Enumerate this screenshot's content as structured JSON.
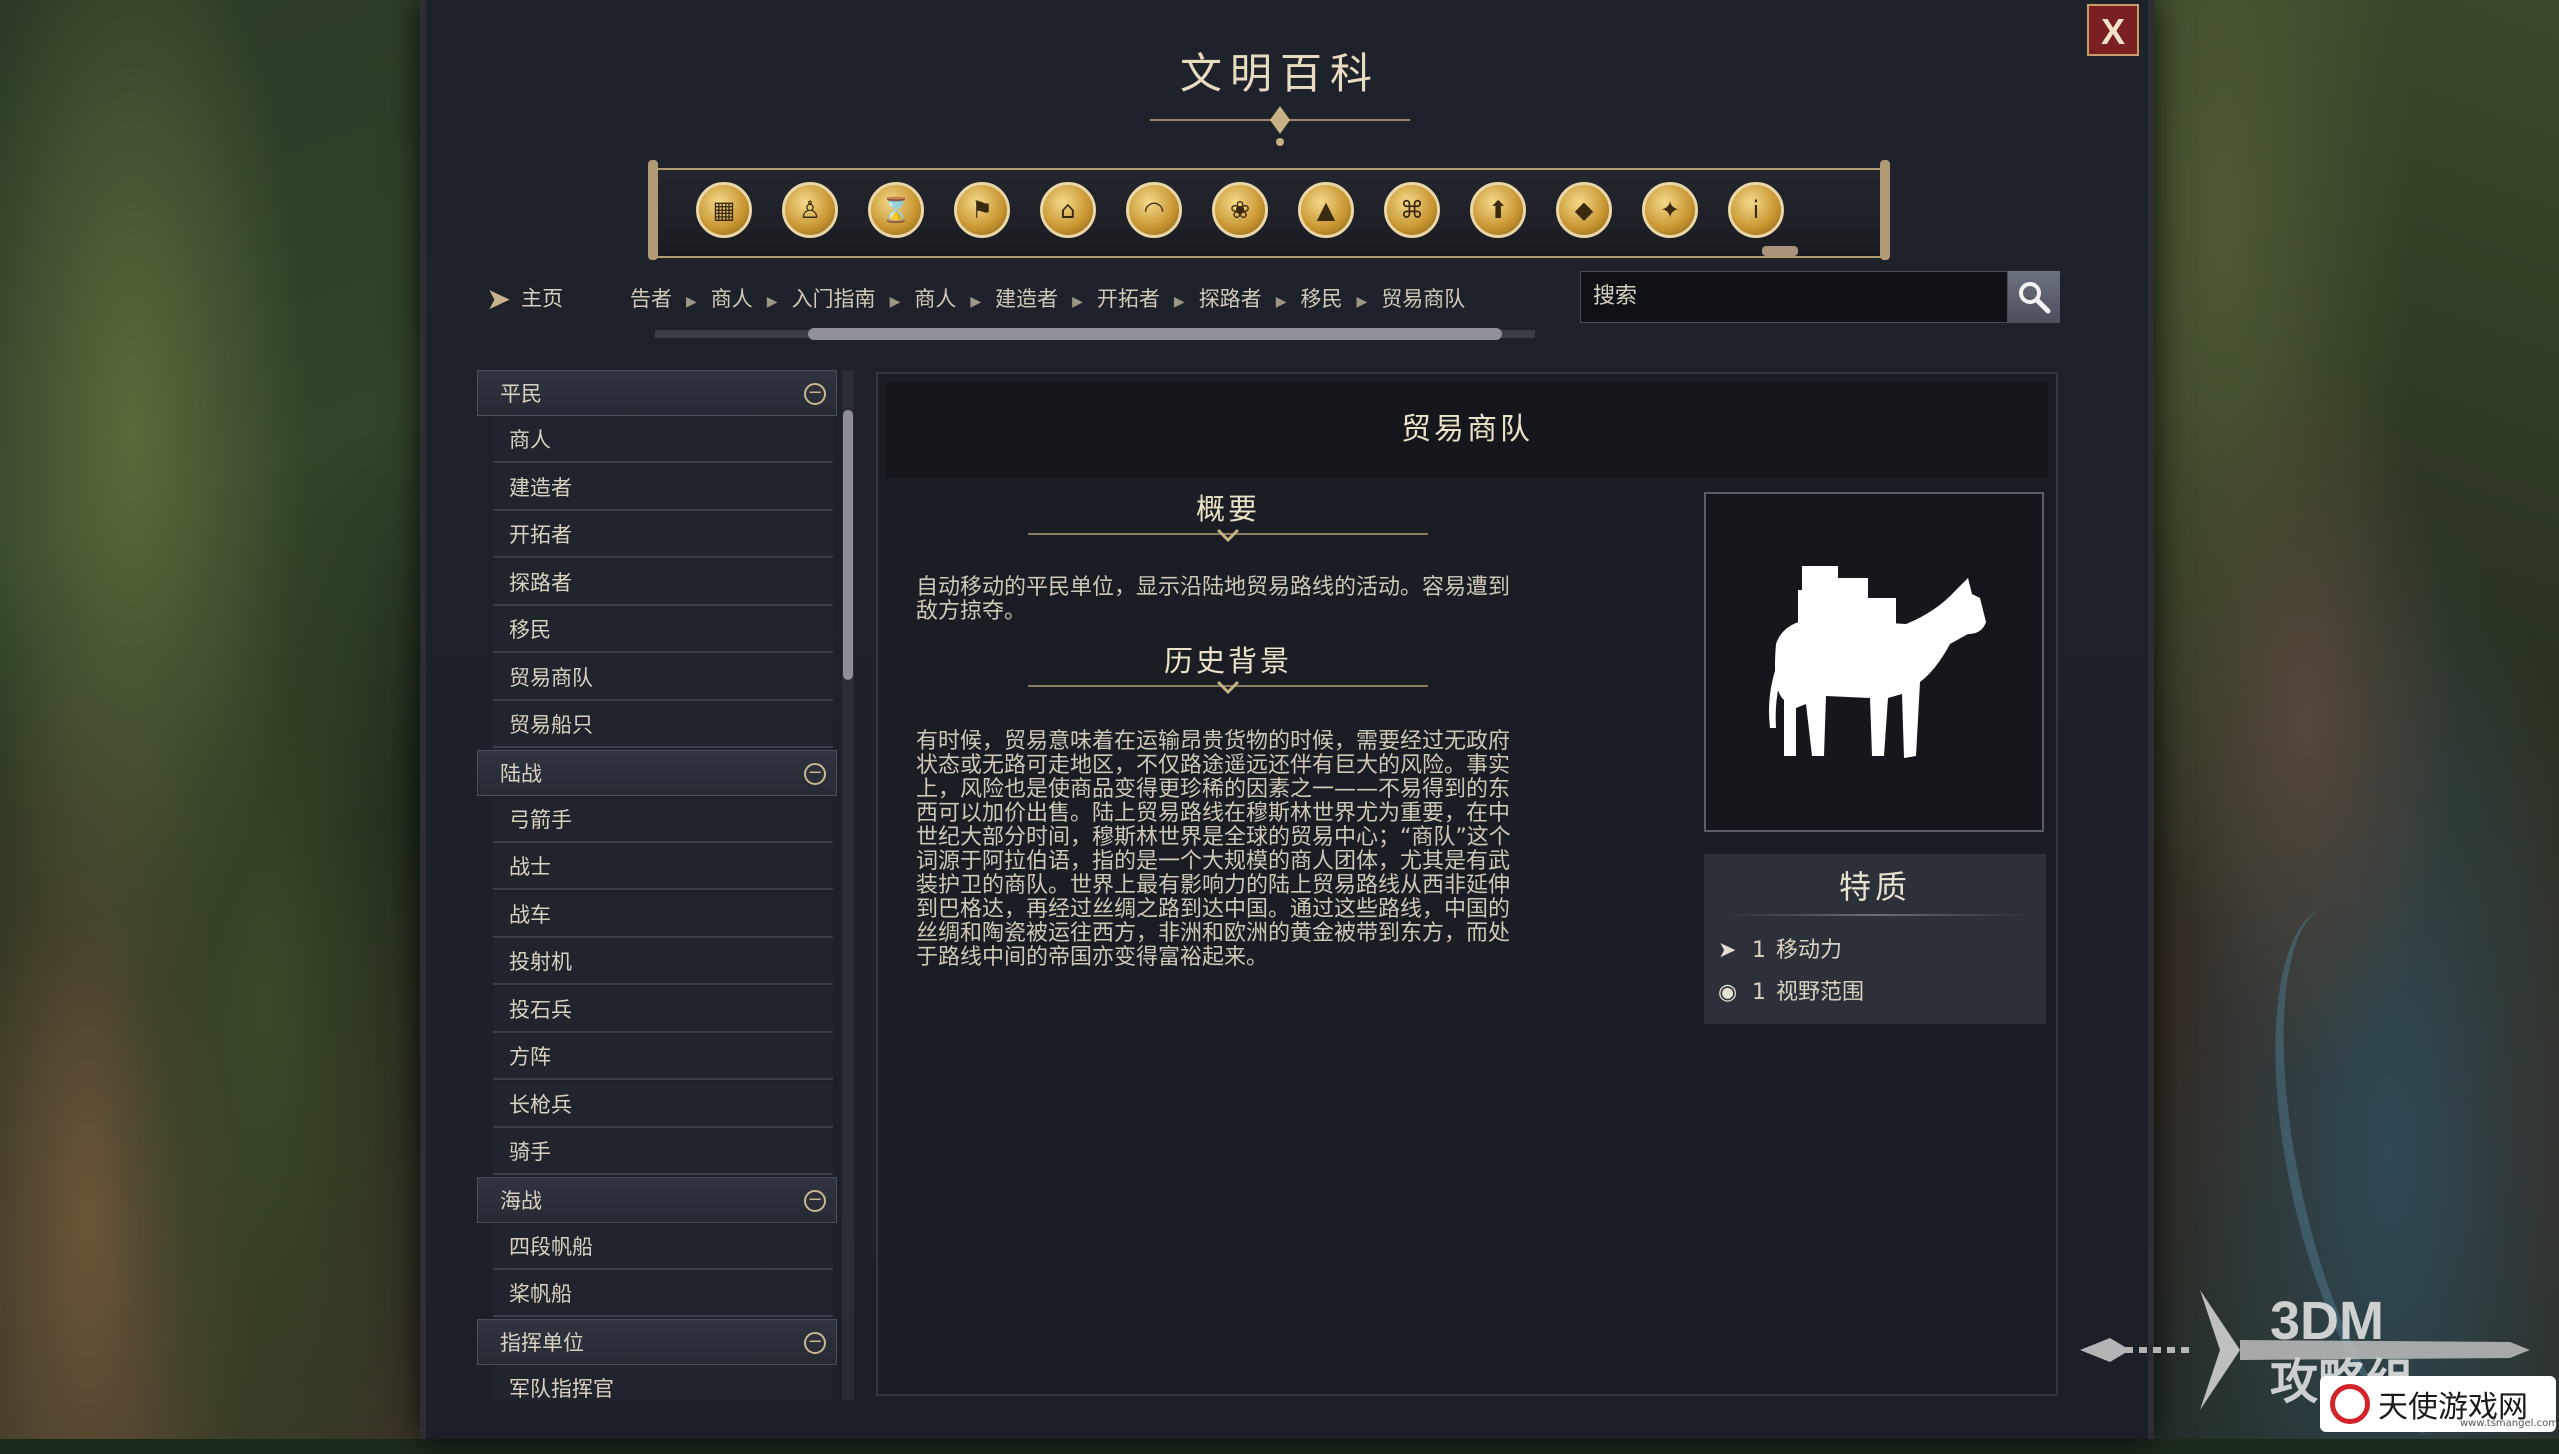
{
  "window": {
    "title": "文明百科",
    "close_label": "X"
  },
  "category_icons": [
    {
      "name": "units-icon",
      "glyph": "▦"
    },
    {
      "name": "resources-icon",
      "glyph": "♙"
    },
    {
      "name": "ages-icon",
      "glyph": "⌛"
    },
    {
      "name": "civilizations-icon",
      "glyph": "⚑"
    },
    {
      "name": "buildings-icon",
      "glyph": "⌂"
    },
    {
      "name": "tiles-icon",
      "glyph": "◠"
    },
    {
      "name": "traditions-icon",
      "glyph": "❀"
    },
    {
      "name": "wonders-icon",
      "glyph": "▲"
    },
    {
      "name": "districts-icon",
      "glyph": "⌘"
    },
    {
      "name": "improvements-icon",
      "glyph": "⬆"
    },
    {
      "name": "technology-icon",
      "glyph": "◆"
    },
    {
      "name": "diplomacy-icon",
      "glyph": "✦"
    },
    {
      "name": "info-icon",
      "glyph": "i"
    }
  ],
  "nav": {
    "home_label": "主页",
    "breadcrumbs": [
      "告者",
      "商人",
      "入门指南",
      "商人",
      "建造者",
      "开拓者",
      "探路者",
      "移民",
      "贸易商队"
    ],
    "search_placeholder": "搜索"
  },
  "sidebar": {
    "groups": [
      {
        "label": "平民",
        "items": [
          "商人",
          "建造者",
          "开拓者",
          "探路者",
          "移民",
          "贸易商队",
          "贸易船只"
        ]
      },
      {
        "label": "陆战",
        "items": [
          "弓箭手",
          "战士",
          "战车",
          "投射机",
          "投石兵",
          "方阵",
          "长枪兵",
          "骑手"
        ]
      },
      {
        "label": "海战",
        "items": [
          "四段帆船",
          "桨帆船"
        ]
      },
      {
        "label": "指挥单位",
        "items": [
          "军队指挥官"
        ]
      }
    ]
  },
  "article": {
    "title": "贸易商队",
    "overview_heading": "概要",
    "overview_text": "自动移动的平民单位，显示沿陆地贸易路线的活动。容易遭到敌方掠夺。",
    "history_heading": "历史背景",
    "history_text": "有时候，贸易意味着在运输昂贵货物的时候，需要经过无政府状态或无路可走地区，不仅路途遥远还伴有巨大的风险。事实上，风险也是使商品变得更珍稀的因素之一——不易得到的东西可以加价出售。陆上贸易路线在穆斯林世界尤为重要，在中世纪大部分时间，穆斯林世界是全球的贸易中心；“商队”这个词源于阿拉伯语，指的是一个大规模的商人团体，尤其是有武装护卫的商队。世界上最有影响力的陆上贸易路线从西非延伸到巴格达，再经过丝绸之路到达中国。通过这些路线，中国的丝绸和陶瓷被运往西方，非洲和欧洲的黄金被带到东方，而处于路线中间的帝国亦变得富裕起来。",
    "traits_heading": "特质",
    "traits": [
      {
        "icon": "movement-icon",
        "glyph": "➤",
        "value": "1",
        "label": "移动力"
      },
      {
        "icon": "sight-icon",
        "glyph": "◉",
        "value": "1",
        "label": "视野范围"
      }
    ]
  },
  "watermark": {
    "brand_top": "3DM",
    "brand_bottom": "攻略组",
    "site": "天使游戏网",
    "site_url": "www.tsmangel.com"
  }
}
